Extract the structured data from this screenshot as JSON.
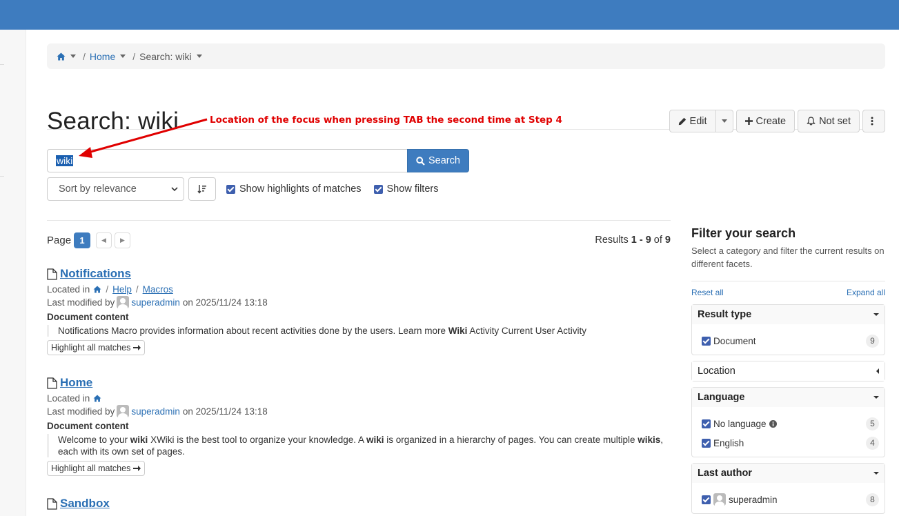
{
  "breadcrumb": {
    "home_icon": "home-icon",
    "home": "Home",
    "current": "Search: wiki"
  },
  "page": {
    "title": "Search: wiki"
  },
  "actions": {
    "edit": "Edit",
    "create": "Create",
    "not_set": "Not set"
  },
  "annotation": {
    "text": "Location of the focus when pressing TAB the second time at Step 4",
    "color": "#e00000"
  },
  "search": {
    "value": "wiki",
    "button": "Search"
  },
  "controls": {
    "sort": "Sort by relevance",
    "show_highlights": "Show highlights of matches",
    "show_filters": "Show filters"
  },
  "pager": {
    "label": "Page",
    "current": "1",
    "results_prefix": "Results ",
    "range": "1 - 9",
    "of": " of ",
    "total": "9"
  },
  "results": [
    {
      "title": "Notifications",
      "located_in_label": "Located in",
      "path": [
        "Help",
        "Macros"
      ],
      "modified_label": "Last modified by",
      "author": "superadmin",
      "on": "on 2025/11/24 13:18",
      "content_label": "Document content",
      "excerpt_pre": "Notifications Macro provides information about recent activities done by the users. Learn more ",
      "excerpt_hl": "Wiki",
      "excerpt_post": " Activity Current User Activity",
      "highlight_btn": "Highlight all matches"
    },
    {
      "title": "Home",
      "located_in_label": "Located in",
      "modified_label": "Last modified by",
      "author": "superadmin",
      "on": "on 2025/11/24 13:18",
      "content_label": "Document content",
      "excerpt_1": "Welcome to your ",
      "hl_1": "wiki",
      "excerpt_2": " XWiki is the best tool to organize your knowledge. A ",
      "hl_2": "wiki",
      "excerpt_3": " is organized in a hierarchy of pages. You can create multiple ",
      "hl_3": "wikis",
      "excerpt_4": ", each with its own set of pages.",
      "highlight_btn": "Highlight all matches"
    },
    {
      "title": "Sandbox"
    }
  ],
  "filters": {
    "title": "Filter your search",
    "description": "Select a category and filter the current results on different facets.",
    "reset_all": "Reset all",
    "expand_all": "Expand all",
    "result_type": {
      "label": "Result type",
      "items": [
        {
          "label": "Document",
          "count": "9"
        }
      ]
    },
    "location": {
      "label": "Location"
    },
    "language": {
      "label": "Language",
      "items": [
        {
          "label": "No language",
          "count": "5"
        },
        {
          "label": "English",
          "count": "4"
        }
      ]
    },
    "last_author": {
      "label": "Last author",
      "items": [
        {
          "label": "superadmin",
          "count": "8"
        }
      ]
    }
  },
  "colors": {
    "topbar": "#3e7cbf",
    "link": "#2a6fb4",
    "primary_button": "#3e7cbf"
  }
}
